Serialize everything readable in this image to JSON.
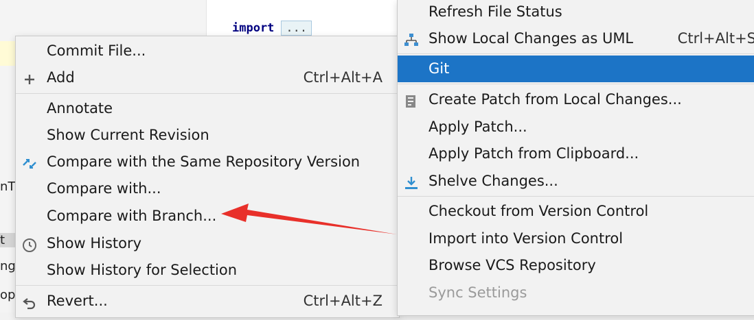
{
  "editor": {
    "code_keyword": "import",
    "code_fold": "...",
    "left_fragments": [
      "nT",
      "t",
      "ng",
      "op"
    ]
  },
  "left_menu": {
    "items": [
      {
        "label": "Commit File...",
        "shortcut": "",
        "icon": ""
      },
      {
        "label": "Add",
        "shortcut": "Ctrl+Alt+A",
        "icon": "plus-icon"
      },
      {
        "label": "Annotate",
        "shortcut": "",
        "icon": ""
      },
      {
        "label": "Show Current Revision",
        "shortcut": "",
        "icon": ""
      },
      {
        "label": "Compare with the Same Repository Version",
        "shortcut": "",
        "icon": "compare-arrows-icon"
      },
      {
        "label": "Compare with...",
        "shortcut": "",
        "icon": ""
      },
      {
        "label": "Compare with Branch...",
        "shortcut": "",
        "icon": ""
      },
      {
        "label": "Show History",
        "shortcut": "",
        "icon": "clock-icon"
      },
      {
        "label": "Show History for Selection",
        "shortcut": "",
        "icon": ""
      },
      {
        "label": "Revert...",
        "shortcut": "Ctrl+Alt+Z",
        "icon": "revert-icon"
      }
    ]
  },
  "right_menu": {
    "items": [
      {
        "label": "Refresh File Status",
        "shortcut": "",
        "icon": ""
      },
      {
        "label": "Show Local Changes as UML",
        "shortcut": "Ctrl+Alt+S",
        "icon": "uml-diagram-icon"
      },
      {
        "label": "Git",
        "shortcut": "",
        "icon": "",
        "selected": true
      },
      {
        "label": "Create Patch from Local Changes...",
        "shortcut": "",
        "icon": "patch-icon"
      },
      {
        "label": "Apply Patch...",
        "shortcut": "",
        "icon": ""
      },
      {
        "label": "Apply Patch from Clipboard...",
        "shortcut": "",
        "icon": ""
      },
      {
        "label": "Shelve Changes...",
        "shortcut": "",
        "icon": "shelve-icon"
      },
      {
        "label": "Checkout from Version Control",
        "shortcut": "",
        "icon": ""
      },
      {
        "label": "Import into Version Control",
        "shortcut": "",
        "icon": ""
      },
      {
        "label": "Browse VCS Repository",
        "shortcut": "",
        "icon": ""
      },
      {
        "label": "Sync Settings",
        "shortcut": "",
        "icon": "",
        "disabled": true
      }
    ]
  },
  "colors": {
    "selection": "#1c74c6",
    "arrow": "#e8302a",
    "menu_bg": "#f2f2f2"
  }
}
